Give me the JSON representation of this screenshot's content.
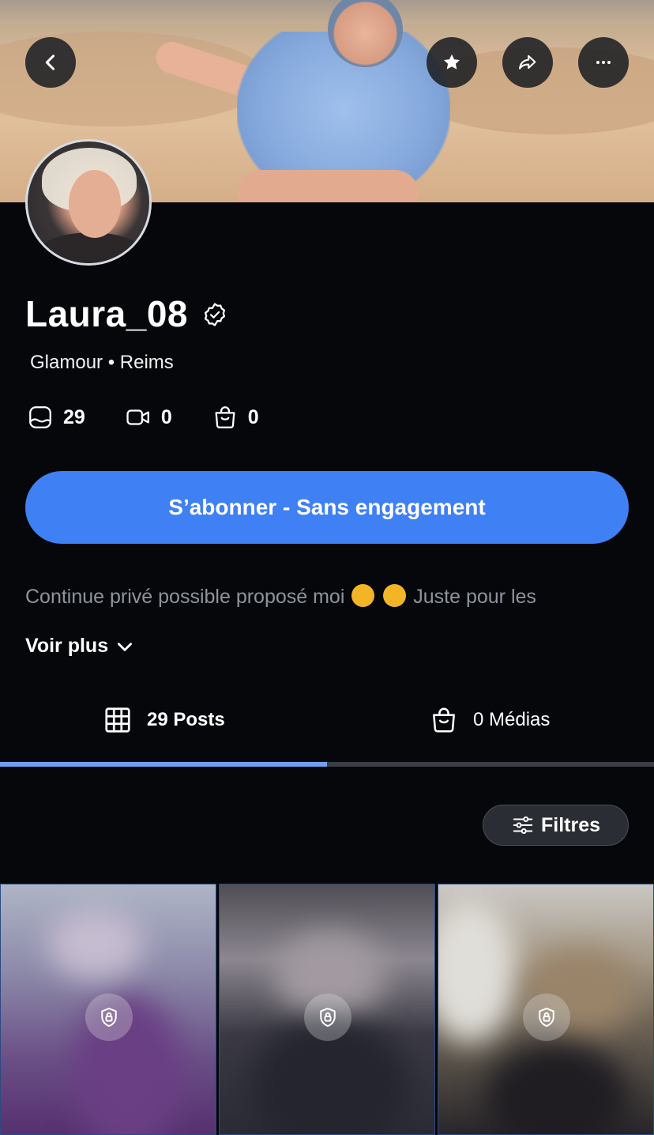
{
  "header": {
    "back_icon": "chevron-left-icon",
    "favorite_icon": "star-icon",
    "share_icon": "share-arrow-icon",
    "more_icon": "more-horizontal-icon"
  },
  "profile": {
    "name": "Laura_08",
    "verified_icon": "verified-badge-icon",
    "meta": "Glamour • Reims",
    "stats": [
      {
        "icon": "photo-icon",
        "value": "29"
      },
      {
        "icon": "video-icon",
        "value": "0"
      },
      {
        "icon": "shopping-bag-icon",
        "value": "0"
      }
    ],
    "subscribe_label": "S’abonner - Sans engagement",
    "bio_part1": "Continue privé possible proposé moi",
    "bio_part2": "Juste pour les",
    "voir_plus_label": "Voir plus"
  },
  "tabs": [
    {
      "icon": "grid-icon",
      "label": "29 Posts",
      "active": true
    },
    {
      "icon": "shopping-bag-icon",
      "label": "0 Médias",
      "active": false
    }
  ],
  "filters_label": "Filtres",
  "colors": {
    "background": "#05070b",
    "accent": "#3f80f5",
    "tab_indicator": "#6fa0f2"
  },
  "posts": [
    {
      "locked": true
    },
    {
      "locked": true
    },
    {
      "locked": true
    }
  ]
}
